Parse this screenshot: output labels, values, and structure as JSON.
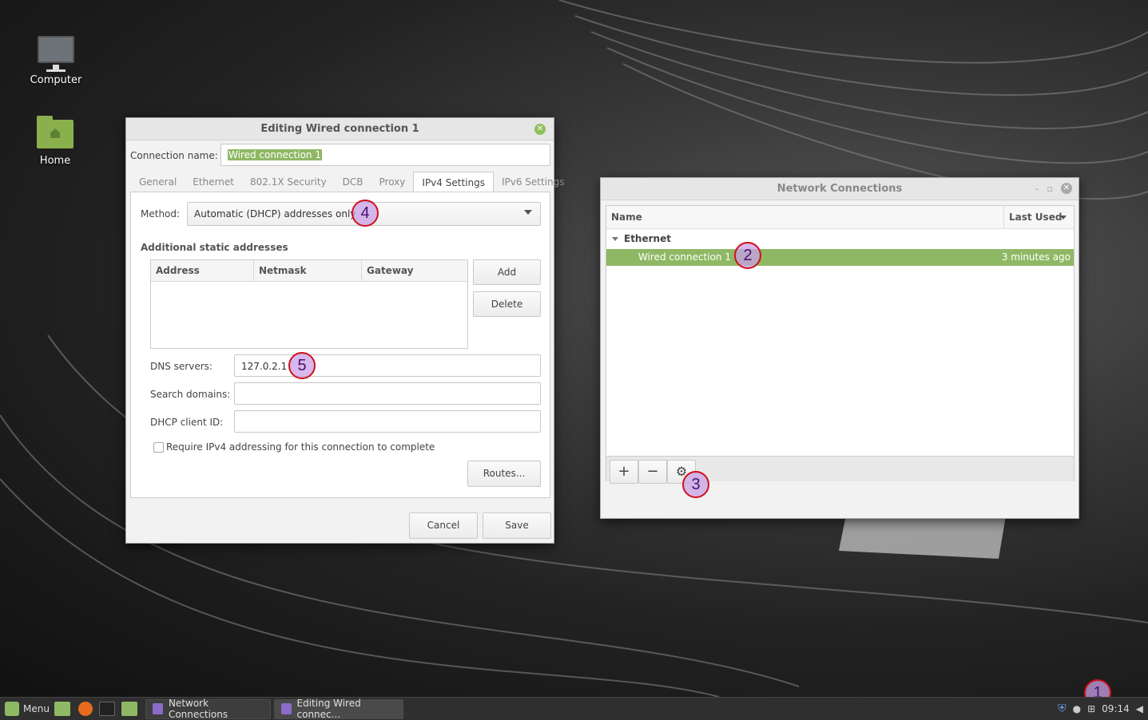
{
  "desktop": {
    "icons": [
      {
        "label": "Computer",
        "icon": "computer-icon"
      },
      {
        "label": "Home",
        "icon": "home-folder-icon"
      }
    ]
  },
  "editor": {
    "title": "Editing Wired connection 1",
    "connection_name_label": "Connection name:",
    "connection_name_value": "Wired connection 1",
    "tabs": [
      "General",
      "Ethernet",
      "802.1X Security",
      "DCB",
      "Proxy",
      "IPv4 Settings",
      "IPv6 Settings"
    ],
    "active_tab": "IPv4 Settings",
    "method_label": "Method:",
    "method_value": "Automatic (DHCP) addresses only",
    "static_heading": "Additional static addresses",
    "columns": [
      "Address",
      "Netmask",
      "Gateway"
    ],
    "add_label": "Add",
    "delete_label": "Delete",
    "dns_label": "DNS servers:",
    "dns_value": "127.0.2.1",
    "search_label": "Search domains:",
    "search_value": "",
    "dhcp_label": "DHCP client ID:",
    "dhcp_value": "",
    "require_label": "Require IPv4 addressing for this connection to complete",
    "routes_label": "Routes...",
    "cancel_label": "Cancel",
    "save_label": "Save"
  },
  "netconn": {
    "title": "Network Connections",
    "col_name": "Name",
    "col_last_used": "Last Used",
    "group": "Ethernet",
    "row_name": "Wired connection 1",
    "row_last_used": "3 minutes ago",
    "add_symbol": "+",
    "remove_symbol": "−",
    "settings_symbol": "⚙"
  },
  "badges": [
    "1",
    "2",
    "3",
    "4",
    "5"
  ],
  "taskbar": {
    "menu_label": "Menu",
    "tasks": [
      "Network Connections",
      "Editing Wired connec..."
    ],
    "clock": "09:14"
  },
  "colors": {
    "accent": "#8fb865",
    "badge_ring": "#d0101a",
    "badge_fill": "#c8a0e6"
  }
}
